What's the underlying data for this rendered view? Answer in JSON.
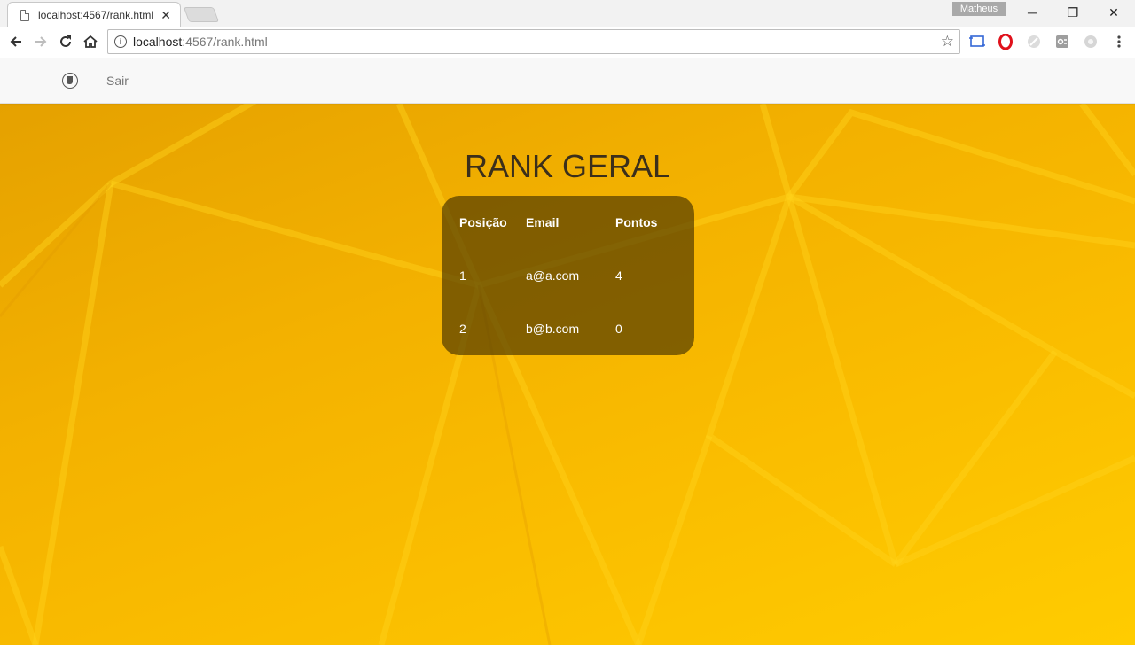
{
  "browser": {
    "tab_title": "localhost:4567/rank.html",
    "tab_close": "✕",
    "profile_name": "Matheus",
    "url_host": "localhost",
    "url_path": ":4567/rank.html",
    "window_min": "─",
    "window_max": "❐",
    "window_close": "✕"
  },
  "navbar": {
    "logout_label": "Sair"
  },
  "main": {
    "title": "RANK GERAL",
    "table": {
      "headers": [
        "Posição",
        "Email",
        "Pontos"
      ],
      "rows": [
        [
          "1",
          "a@a.com",
          "4"
        ],
        [
          "2",
          "b@b.com",
          "0"
        ]
      ]
    }
  },
  "colors": {
    "accent": "#f9bb00",
    "card_bg": "rgba(70, 50, 0, 0.66)",
    "title_text": "#3b2f1b"
  }
}
